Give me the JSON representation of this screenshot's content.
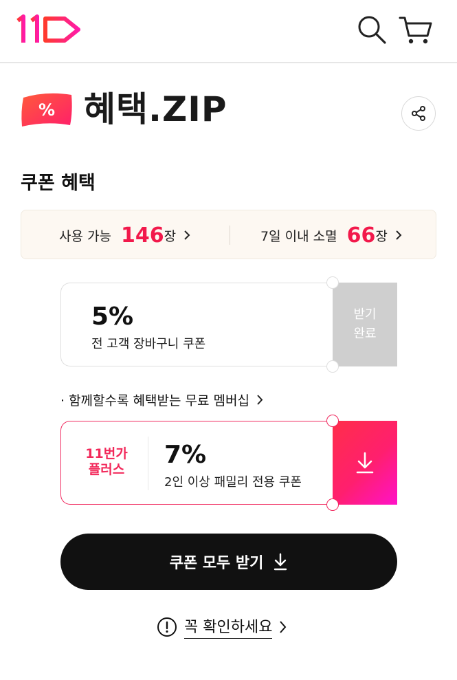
{
  "header": {
    "logo_text": "11",
    "search_icon": "search-icon",
    "cart_icon": "cart-icon"
  },
  "hero": {
    "badge_text": "%",
    "title": "혜택.ZIP",
    "share_icon": "share-icon"
  },
  "coupons_section": {
    "title": "쿠폰 혜택",
    "summary": {
      "available_label": "사용 가능",
      "available_count": "146",
      "available_unit": "장",
      "expiring_label": "7일 이내 소멸",
      "expiring_count": "66",
      "expiring_unit": "장"
    }
  },
  "coupon_1": {
    "percent": "5%",
    "description": "전 고객 장바구니 쿠폰",
    "status_line1": "받기",
    "status_line2": "완료"
  },
  "membership_link": "· 함께할수록 혜택받는 무료 멤버십",
  "coupon_2": {
    "brand_line1": "11번가",
    "brand_line2": "플러스",
    "percent": "7%",
    "description": "2인 이상 패밀리 전용 쿠폰",
    "action_icon": "download-icon"
  },
  "download_all_label": "쿠폰 모두 받기",
  "notice_label": "꼭 확인하세요",
  "colors": {
    "brand_red": "#f2194b",
    "brand_pink": "#ff12c8",
    "dark": "#111111",
    "disabled": "#cfcfcf"
  }
}
